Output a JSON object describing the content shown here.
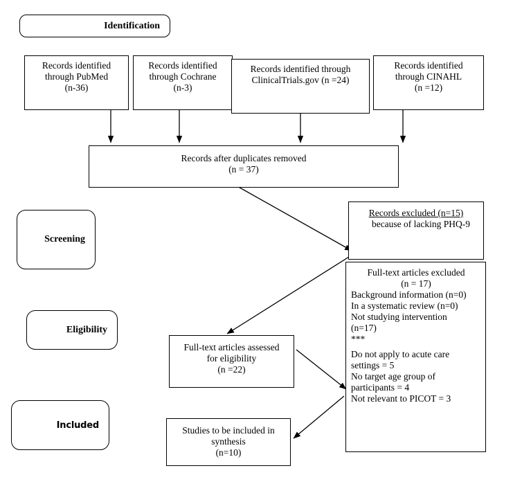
{
  "diagram": {
    "type": "prisma-flow-diagram",
    "stages": [
      {
        "id": "identification",
        "label": "Identification"
      },
      {
        "id": "screening",
        "label": "Screening"
      },
      {
        "id": "eligibility",
        "label": "Eligibility"
      },
      {
        "id": "included",
        "label": "Included"
      }
    ],
    "sources": [
      {
        "id": "pubmed",
        "line1": "Records identified",
        "line2": "through PubMed",
        "count": "(n-36)"
      },
      {
        "id": "cochrane",
        "line1": "Records identified",
        "line2": "through Cochrane",
        "count": "(n-3)"
      },
      {
        "id": "clinicaltrials",
        "line1": "Records identified through",
        "line2": "ClinicalTrials.gov (n =24)",
        "count": ""
      },
      {
        "id": "cinahl",
        "line1": "Records identified",
        "line2": "through CINAHL",
        "count": "(n =12)"
      }
    ],
    "duplicates_removed": {
      "label": "Records after duplicates removed",
      "count": "(n = 37)"
    },
    "records_excluded": {
      "heading": "Records excluded (n=15)",
      "reason": "because of lacking PHQ-9"
    },
    "fulltext_excluded": {
      "title": "Full-text articles excluded",
      "count": "(n = 17)",
      "reasons": [
        "Background information (n=0)",
        "In a systematic review (n=0)",
        "Not studying intervention",
        "(n=17)"
      ],
      "separator": "***",
      "detail_reasons": [
        "Do not apply to acute care",
        "settings = 5",
        "No target age group of",
        "participants = 4",
        "Not relevant to PICOT = 3"
      ]
    },
    "fulltext_assessed": {
      "line1": "Full-text articles assessed",
      "line2": "for eligibility",
      "count": "(n =22)"
    },
    "studies_included": {
      "line1": "Studies to be included in",
      "line2": "synthesis",
      "count": "(n=10)"
    },
    "colors": {
      "stroke": "#000000",
      "background": "#ffffff",
      "text": "#000000"
    }
  }
}
